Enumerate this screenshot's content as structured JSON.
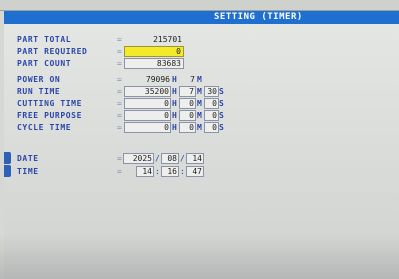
{
  "title": "SETTING (TIMER)",
  "colors": {
    "title_bar": "#1f6fd0",
    "label": "#2d47a8",
    "highlight": "#f3ea2a"
  },
  "rows": {
    "part_total": {
      "label": "PART TOTAL",
      "value": "215701"
    },
    "part_required": {
      "label": "PART REQUIRED",
      "value": "0"
    },
    "part_count": {
      "label": "PART COUNT",
      "value": "83683"
    },
    "power_on": {
      "label": "POWER ON",
      "hours": "79096",
      "h": "H",
      "minutes": "7",
      "m": "M"
    },
    "run_time": {
      "label": "RUN TIME",
      "hours": "35200",
      "h": "H",
      "minutes": "7",
      "m": "M",
      "seconds": "30",
      "s": "S"
    },
    "cutting_time": {
      "label": "CUTTING TIME",
      "hours": "0",
      "h": "H",
      "minutes": "0",
      "m": "M",
      "seconds": "0",
      "s": "S"
    },
    "free_purpose": {
      "label": "FREE PURPOSE",
      "hours": "0",
      "h": "H",
      "minutes": "0",
      "m": "M",
      "seconds": "0",
      "s": "S"
    },
    "cycle_time": {
      "label": "CYCLE TIME",
      "hours": "0",
      "h": "H",
      "minutes": "0",
      "m": "M",
      "seconds": "0",
      "s": "S"
    },
    "date": {
      "label": "DATE",
      "year": "2025",
      "month": "08",
      "day": "14"
    },
    "time": {
      "label": "TIME",
      "hour": "14",
      "minute": "16",
      "second": "47"
    }
  },
  "eq_sign": "="
}
